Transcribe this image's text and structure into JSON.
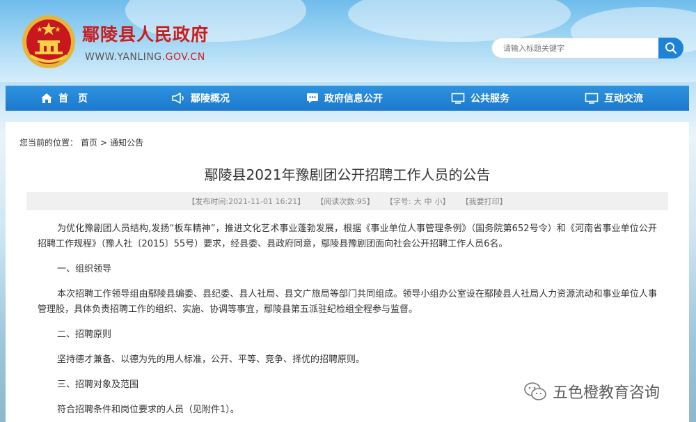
{
  "header": {
    "site_title": "鄢陵县人民政府",
    "site_url_prefix": "WWW.YANLING",
    "site_url_suffix": ".GOV.CN",
    "search_placeholder": "请输入标题关键字"
  },
  "nav": {
    "items": [
      {
        "label": "首　页",
        "icon": "home-icon"
      },
      {
        "label": "鄢陵概况",
        "icon": "megaphone-icon"
      },
      {
        "label": "政府信息公开",
        "icon": "chat-icon"
      },
      {
        "label": "公共服务",
        "icon": "monitor-icon"
      },
      {
        "label": "互动交流",
        "icon": "monitor-icon"
      }
    ]
  },
  "breadcrumb": {
    "prefix": "您当前的位置：",
    "home": "首页",
    "sep": ">",
    "current": "通知公告"
  },
  "article": {
    "title": "鄢陵县2021年豫剧团公开招聘工作人员的公告",
    "publish_time": "【发布时间:2021-11-01 16:21】",
    "views": "【阅读次数:95】",
    "font_size_label": "【字号:",
    "font_large": "大",
    "font_medium": "中",
    "font_small": "小】",
    "print": "【我要打印】",
    "p1": "为优化豫剧团人员结构,发扬“板车精神”，推进文化艺术事业蓬勃发展，根据《事业单位人事管理条例》（国务院第652号令）和《河南省事业单位公开招聘工作规程》（豫人社〔2015〕55号）要求，经县委、县政府同意，鄢陵县豫剧团面向社会公开招聘工作人员6名。",
    "h1": "一、组织领导",
    "p2": "本次招聘工作领导组由鄢陵县编委、县纪委、县人社局、县文广旅局等部门共同组成。领导小组办公室设在鄢陵县人社局人力资源流动和事业单位人事管理股，具体负责招聘工作的组织、实施、协调等事宜，鄢陵县第五派驻纪检组全程参与监督。",
    "h2": "二、招聘原则",
    "p3": "坚持德才兼备、以德为先的用人标准，公开、平等、竞争、择优的招聘原则。",
    "h3": "三、招聘对象及范围",
    "p4": "符合招聘条件和岗位要求的人员（见附件1）。"
  },
  "watermark": {
    "text": "五色橙教育咨询"
  },
  "colors": {
    "brand_red": "#c81e1e",
    "nav_blue": "#1a78cd",
    "search_blue": "#1e82d6"
  }
}
